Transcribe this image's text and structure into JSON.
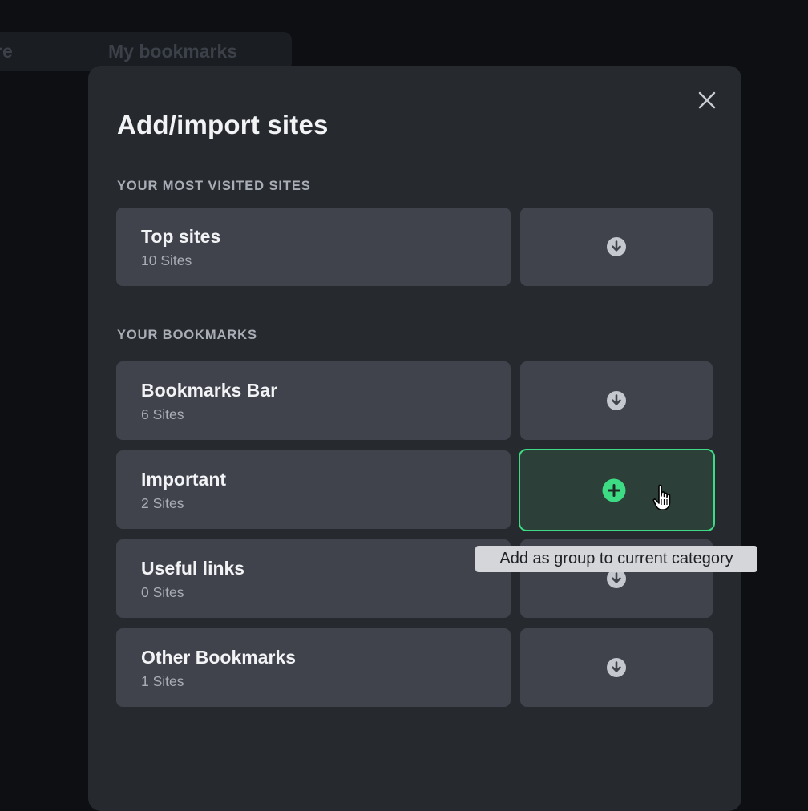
{
  "background": {
    "tabs": [
      "re",
      "My bookmarks"
    ]
  },
  "modal": {
    "title": "Add/import sites",
    "close_icon": "close-icon",
    "sections": [
      {
        "label": "YOUR MOST VISITED SITES",
        "rows": [
          {
            "title": "Top sites",
            "subtitle": "10 Sites",
            "action": "import",
            "icon": "arrow-down-circle-icon"
          }
        ]
      },
      {
        "label": "YOUR BOOKMARKS",
        "rows": [
          {
            "title": "Bookmarks Bar",
            "subtitle": "6 Sites",
            "action": "import",
            "icon": "arrow-down-circle-icon"
          },
          {
            "title": "Important",
            "subtitle": "2 Sites",
            "action": "add-group",
            "icon": "plus-circle-icon",
            "hovered": true
          },
          {
            "title": "Useful links",
            "subtitle": "0 Sites",
            "action": "import",
            "icon": "arrow-down-circle-icon"
          },
          {
            "title": "Other Bookmarks",
            "subtitle": "1 Sites",
            "action": "import",
            "icon": "arrow-down-circle-icon"
          }
        ]
      }
    ],
    "tooltip": "Add as group to current category"
  },
  "colors": {
    "accent_green": "#3ddc84",
    "hover_fill": "#2c3f38",
    "card": "#40434c",
    "modal": "#26292e",
    "page_bg": "#0d0f13"
  },
  "cursor": "hand-pointer-icon"
}
